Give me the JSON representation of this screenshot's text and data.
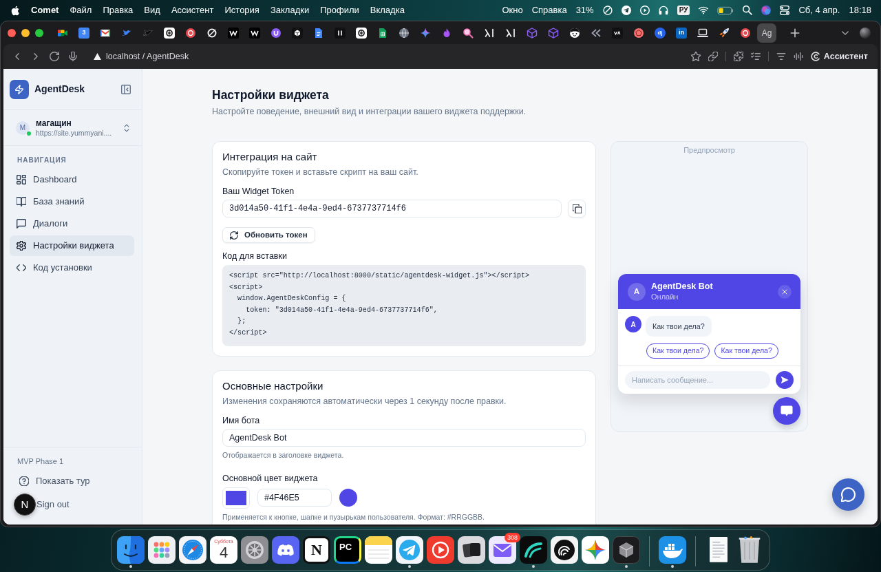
{
  "menu_bar": {
    "app_name": "Comet",
    "menus": [
      "Файл",
      "Правка",
      "Вид",
      "Ассистент",
      "История",
      "Закладки",
      "Профили",
      "Вкладка"
    ],
    "overflow_menus": [
      "Окно",
      "Справка"
    ],
    "battery_percent": "31%",
    "input_source": "РУ",
    "date": "Сб, 4 апр.",
    "time": "18:18"
  },
  "browser": {
    "tabs": [
      {
        "selected": false
      },
      {
        "glyph": "3",
        "selected": false
      },
      {
        "selected": false
      },
      {
        "selected": false
      },
      {
        "selected": false
      },
      {
        "selected": false
      },
      {
        "selected": false
      },
      {
        "selected": false
      },
      {
        "selected": false
      },
      {
        "selected": false
      },
      {
        "selected": false
      },
      {
        "selected": false
      },
      {
        "selected": false
      },
      {
        "selected": false
      },
      {
        "selected": false
      },
      {
        "selected": false
      },
      {
        "selected": false
      },
      {
        "selected": false
      },
      {
        "selected": false
      },
      {
        "selected": false
      },
      {
        "selected": false
      },
      {
        "selected": false
      },
      {
        "selected": false
      },
      {
        "selected": false
      },
      {
        "selected": false
      },
      {
        "selected": false
      },
      {
        "selected": false
      },
      {
        "selected": false
      },
      {
        "glyph": "dj",
        "selected": false
      },
      {
        "glyph": "in",
        "selected": false
      },
      {
        "selected": false
      },
      {
        "selected": false
      },
      {
        "selected": false
      },
      {
        "glyph": "Ag",
        "selected": true
      }
    ],
    "address": "localhost / AgentDesk",
    "assistant_button": "Ассистент"
  },
  "sidebar": {
    "brand": "AgentDesk",
    "workspace": {
      "initial": "М",
      "name": "магащин",
      "url": "https://site.yummyani....",
      "online": true
    },
    "section_label": "НАВИГАЦИЯ",
    "items": [
      {
        "label": "Dashboard",
        "selected": false
      },
      {
        "label": "База знаний",
        "selected": false
      },
      {
        "label": "Диалоги",
        "selected": false
      },
      {
        "label": "Настройки виджета",
        "selected": true
      },
      {
        "label": "Код установки",
        "selected": false
      }
    ],
    "version": "MVP Phase 1",
    "tour_button": "Показать тур",
    "sign_out": "Sign out"
  },
  "dev_indicator": {
    "label": "N"
  },
  "page": {
    "title": "Настройки виджета",
    "subtitle": "Настройте поведение, внешний вид и интеграции вашего виджета поддержки."
  },
  "integration_card": {
    "title": "Интеграция на сайт",
    "description": "Скопируйте токен и вставьте скрипт на ваш сайт.",
    "token_label": "Ваш Widget Token",
    "token_value": "3d014a50-41f1-4e4a-9ed4-6737737714f6",
    "refresh_button": "Обновить токен",
    "code_label": "Код для вставки",
    "code": "<script src=\"http://localhost:8000/static/agentdesk-widget.js\"></script>\n<script>\n  window.AgentDeskConfig = {\n    token: \"3d014a50-41f1-4e4a-9ed4-6737737714f6\",\n  };\n</script>"
  },
  "basic_settings_card": {
    "title": "Основные настройки",
    "description": "Изменения сохраняются автоматически через 1 секунду после правки.",
    "name_field": {
      "label": "Имя бота",
      "value": "AgentDesk Bot",
      "hint": "Отображается в заголовке виджета."
    },
    "color_field": {
      "label": "Основной цвет виджета",
      "value": "#4F46E5",
      "color": "#4f46e5",
      "hint": "Применяется к кнопке, шапке и пузырькам пользователя. Формат: #RRGGBB."
    }
  },
  "preview": {
    "label": "Предпросмотр",
    "widget": {
      "avatar": "A",
      "bot_name": "AgentDesk Bot",
      "status": "Онлайн",
      "messages": [
        {
          "avatar": "A",
          "text": "Как твои дела?"
        }
      ],
      "quick_replies": [
        "Как твои дела?",
        "Как твои дела?"
      ],
      "input_placeholder": "Написать сообщение..."
    }
  },
  "dock": {
    "pinned_apps": [
      {
        "running": true
      },
      {
        "running": false
      },
      {
        "running": false
      },
      {
        "running": false,
        "weekday": "Суббота",
        "day": "4"
      },
      {
        "running": false
      },
      {
        "running": false
      },
      {
        "running": false,
        "glyph": "N"
      },
      {
        "running": false,
        "glyph": "PC"
      },
      {
        "running": false
      },
      {
        "running": true
      },
      {
        "running": false
      },
      {
        "running": false
      },
      {
        "running": false,
        "badge": "308"
      },
      {
        "running": true
      },
      {
        "running": false
      },
      {
        "running": false
      },
      {
        "running": true
      }
    ],
    "recent_apps": [
      {
        "running": true
      }
    ]
  }
}
